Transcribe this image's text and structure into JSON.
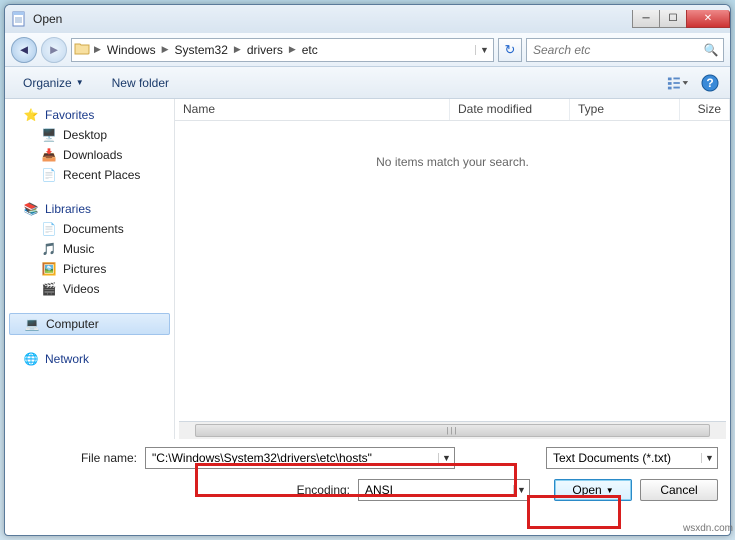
{
  "titlebar": {
    "title": "Open"
  },
  "nav": {
    "crumbs": [
      "Windows",
      "System32",
      "drivers",
      "etc"
    ],
    "search_placeholder": "Search etc"
  },
  "toolbar": {
    "organize": "Organize",
    "newfolder": "New folder"
  },
  "sidebar": {
    "favorites": {
      "label": "Favorites",
      "items": [
        "Desktop",
        "Downloads",
        "Recent Places"
      ]
    },
    "libraries": {
      "label": "Libraries",
      "items": [
        "Documents",
        "Music",
        "Pictures",
        "Videos"
      ]
    },
    "computer": {
      "label": "Computer"
    },
    "network": {
      "label": "Network"
    }
  },
  "columns": {
    "name": "Name",
    "date": "Date modified",
    "type": "Type",
    "size": "Size"
  },
  "list": {
    "empty_msg": "No items match your search."
  },
  "bottom": {
    "filename_label": "File name:",
    "filename_value": "\"C:\\Windows\\System32\\drivers\\etc\\hosts\"",
    "filter_value": "Text Documents (*.txt)",
    "encoding_label": "Encoding:",
    "encoding_value": "ANSI",
    "open": "Open",
    "cancel": "Cancel"
  },
  "watermark": "wsxdn.com"
}
